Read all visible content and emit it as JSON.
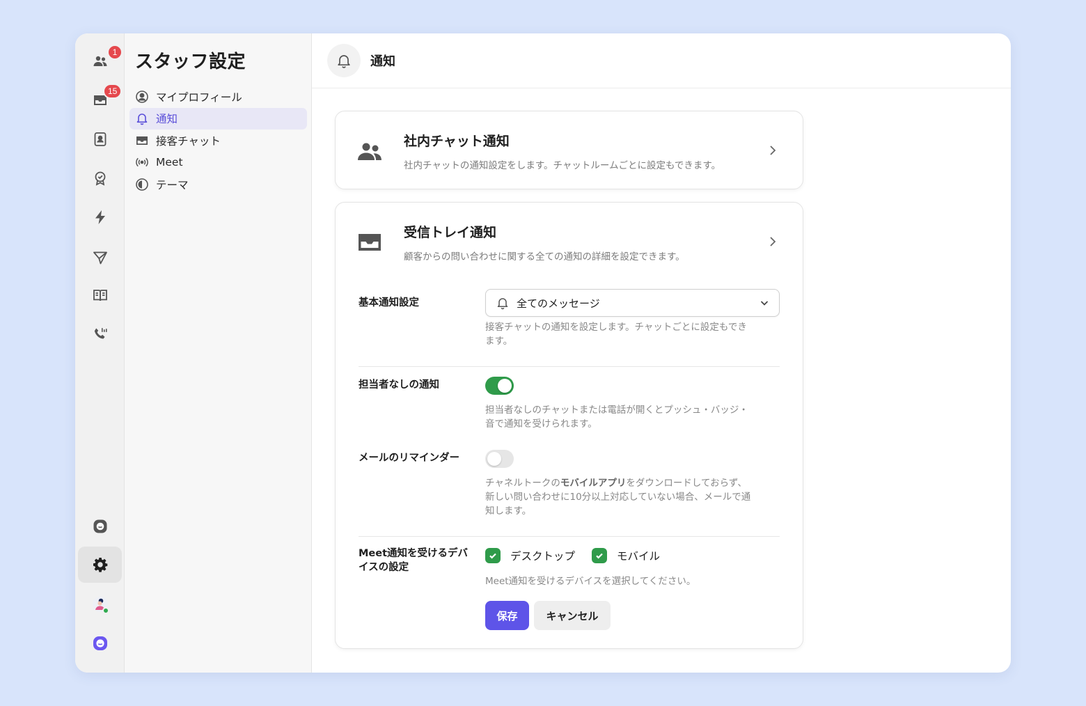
{
  "rail": {
    "team_badge": "1",
    "inbox_badge": "15"
  },
  "sidebar": {
    "title": "スタッフ設定",
    "items": [
      {
        "label": "マイプロフィール"
      },
      {
        "label": "通知"
      },
      {
        "label": "接客チャット"
      },
      {
        "label": "Meet"
      },
      {
        "label": "テーマ"
      }
    ]
  },
  "header": {
    "title": "通知"
  },
  "cards": {
    "team_chat": {
      "title": "社内チャット通知",
      "desc": "社内チャットの通知設定をします。チャットルームごとに設定もできます。"
    },
    "inbox": {
      "title": "受信トレイ通知",
      "desc": "顧客からの問い合わせに関する全ての通知の詳細を設定できます。"
    }
  },
  "settings": {
    "basic": {
      "label": "基本通知設定",
      "value": "全てのメッセージ",
      "help_1": "接客チャットの通知を設定します。チャットごとに設定もでき",
      "help_2": "ます。"
    },
    "unassigned": {
      "label": "担当者なしの通知",
      "enabled": true,
      "help_1": "担当者なしのチャットまたは電話が開くとプッシュ・バッジ・",
      "help_2": "音で通知を受けられます。"
    },
    "email_reminder": {
      "label": "メールのリマインダー",
      "enabled": false,
      "help_pre": "チャネルトークの",
      "help_bold": "モバイルアプリ",
      "help_post": "をダウンロードしておらず、",
      "help_2": "新しい問い合わせに10分以上対応していない場合、メールで通",
      "help_3": "知します。"
    },
    "meet_devices": {
      "label_1": "Meet通知を受けるデバ",
      "label_2": "イスの設定",
      "options": [
        {
          "label": "デスクトップ",
          "checked": true
        },
        {
          "label": "モバイル",
          "checked": true
        }
      ],
      "help": "Meet通知を受けるデバイスを選択してください。"
    }
  },
  "actions": {
    "save": "保存",
    "cancel": "キャンセル"
  },
  "colors": {
    "accent": "#5e54e8",
    "toggle_on": "#2f9b4a",
    "badge": "#e5484d",
    "background": "#d8e4fb"
  }
}
